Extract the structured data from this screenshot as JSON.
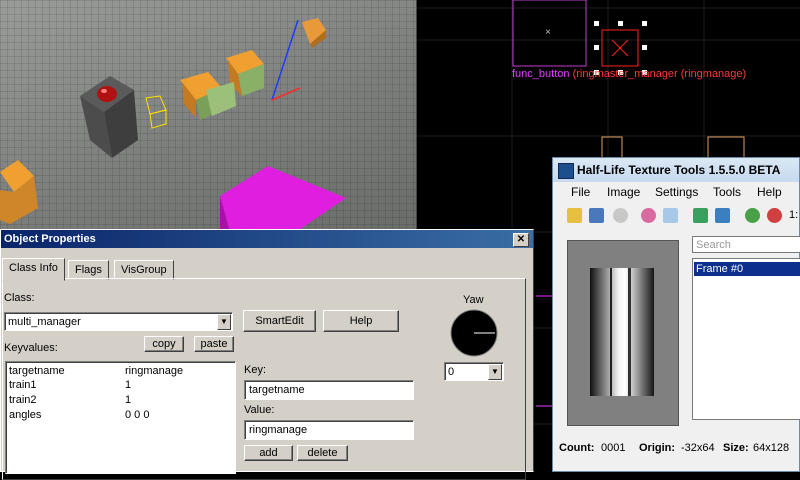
{
  "viewport2d": {
    "entity_class": "func_button",
    "entity_name": "(ringmaster_manager (ringmanage)"
  },
  "object_properties": {
    "title": "Object Properties",
    "close": "✕",
    "tabs": [
      "Class Info",
      "Flags",
      "VisGroup"
    ],
    "class_label": "Class:",
    "class_value": "multi_manager",
    "smartedit": "SmartEdit",
    "help": "Help",
    "yaw_label": "Yaw",
    "yaw_value": "0",
    "keyvalues_label": "Keyvalues:",
    "copy": "copy",
    "paste": "paste",
    "keyvalues": [
      {
        "key": "targetname",
        "value": "ringmanage"
      },
      {
        "key": "train1",
        "value": "1"
      },
      {
        "key": "train2",
        "value": "1"
      },
      {
        "key": "angles",
        "value": "0 0 0"
      }
    ],
    "key_label": "Key:",
    "key_value": "targetname",
    "value_label": "Value:",
    "value_value": "ringmanage",
    "add": "add",
    "delete": "delete"
  },
  "texture_tools": {
    "title": "Half-Life Texture Tools 1.5.5.0 BETA",
    "menu": [
      "File",
      "Image",
      "Settings",
      "Tools",
      "Help"
    ],
    "search_placeholder": "Search",
    "frames": [
      "Frame #0"
    ],
    "status": {
      "count_label": "Count:",
      "count_value": "0001",
      "origin_label": "Origin:",
      "origin_value": "-32x64",
      "size_label": "Size:",
      "size_value": "64x128"
    },
    "toolbar_extra": "1:"
  },
  "colors": {
    "title_bar": "#0a246a",
    "entity_label": "#e23cff",
    "selection": "#0c2e8c"
  }
}
